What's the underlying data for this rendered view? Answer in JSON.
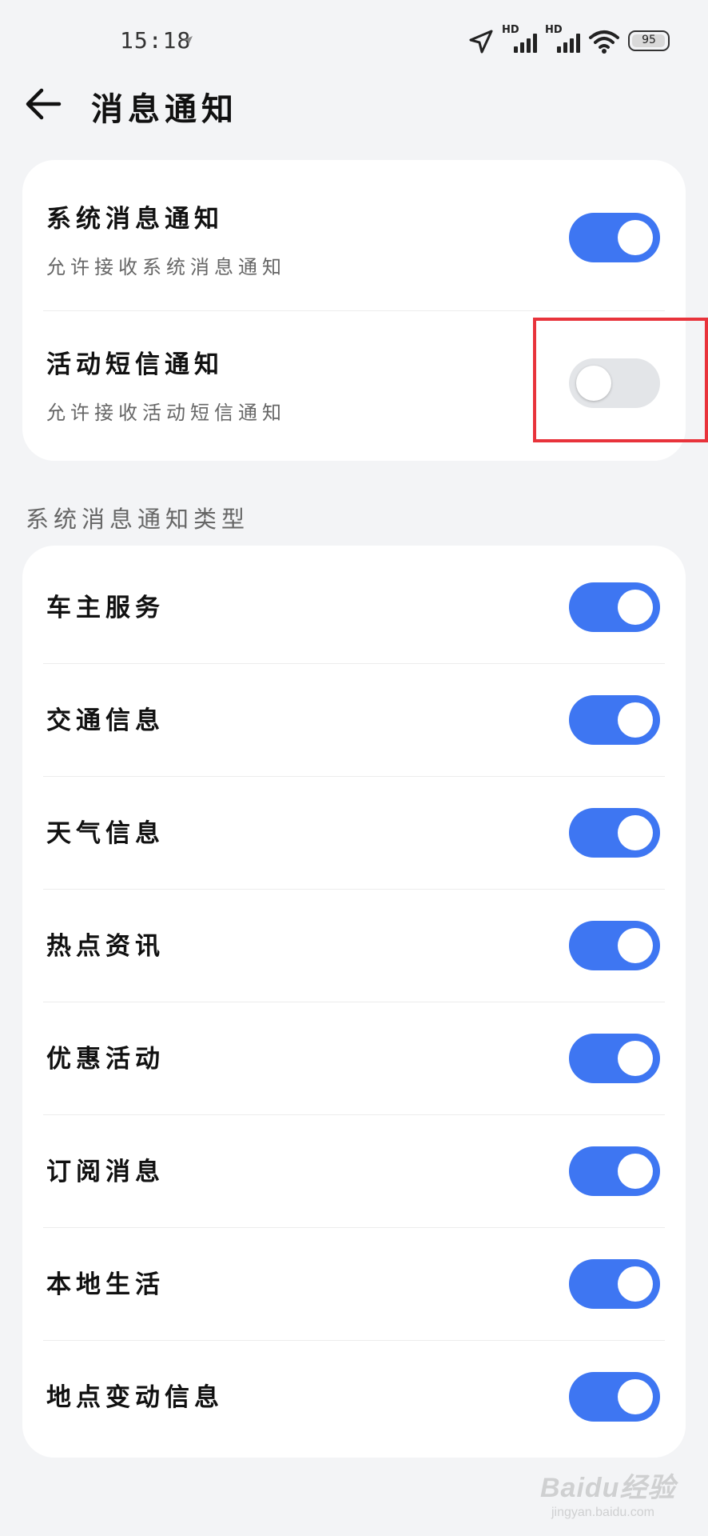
{
  "status_bar": {
    "time": "15:18",
    "hd_label": "HD",
    "battery": "95"
  },
  "header": {
    "title": "消息通知"
  },
  "top_settings": [
    {
      "title": "系统消息通知",
      "subtitle": "允许接收系统消息通知",
      "enabled": true
    },
    {
      "title": "活动短信通知",
      "subtitle": "允许接收活动短信通知",
      "enabled": false
    }
  ],
  "section_label": "系统消息通知类型",
  "notification_types": [
    {
      "label": "车主服务",
      "enabled": true
    },
    {
      "label": "交通信息",
      "enabled": true
    },
    {
      "label": "天气信息",
      "enabled": true
    },
    {
      "label": "热点资讯",
      "enabled": true
    },
    {
      "label": "优惠活动",
      "enabled": true
    },
    {
      "label": "订阅消息",
      "enabled": true
    },
    {
      "label": "本地生活",
      "enabled": true
    },
    {
      "label": "地点变动信息",
      "enabled": true
    }
  ],
  "watermark": {
    "brand": "Baidu经验",
    "url": "jingyan.baidu.com"
  },
  "colors": {
    "accent": "#3e76f2",
    "toggle_off": "#e3e5e8",
    "highlight": "#e8333b",
    "background": "#f3f4f6"
  },
  "icons": [
    "location-arrow-icon",
    "signal-icon",
    "wifi-icon",
    "battery-icon",
    "back-arrow-icon"
  ]
}
